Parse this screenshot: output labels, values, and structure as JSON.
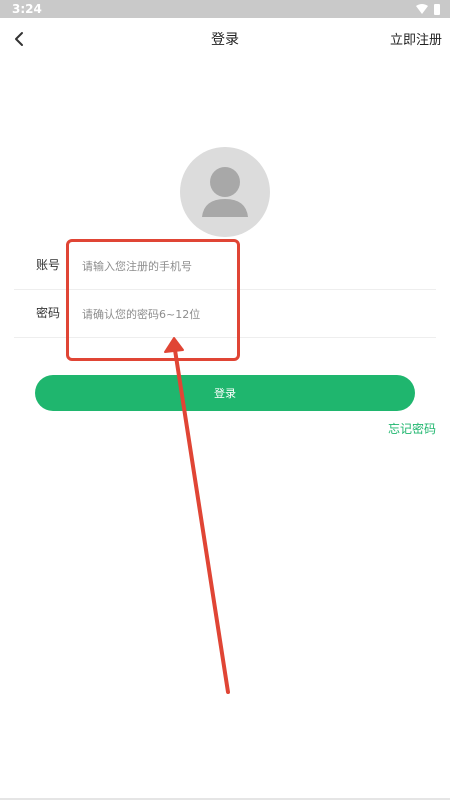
{
  "status_bar": {
    "time": "3:24"
  },
  "header": {
    "title": "登录",
    "register_label": "立即注册"
  },
  "form": {
    "account": {
      "label": "账号",
      "placeholder": "请输入您注册的手机号",
      "value": ""
    },
    "password": {
      "label": "密码",
      "placeholder": "请确认您的密码6~12位",
      "value": ""
    }
  },
  "login_button_label": "登录",
  "forgot_password_label": "忘记密码",
  "colors": {
    "accent": "#1fb66e",
    "annotation": "#e04535",
    "status_bar": "#c9c9c9"
  },
  "icons": [
    "back-icon",
    "avatar-placeholder-icon",
    "wifi-icon",
    "battery-icon"
  ]
}
